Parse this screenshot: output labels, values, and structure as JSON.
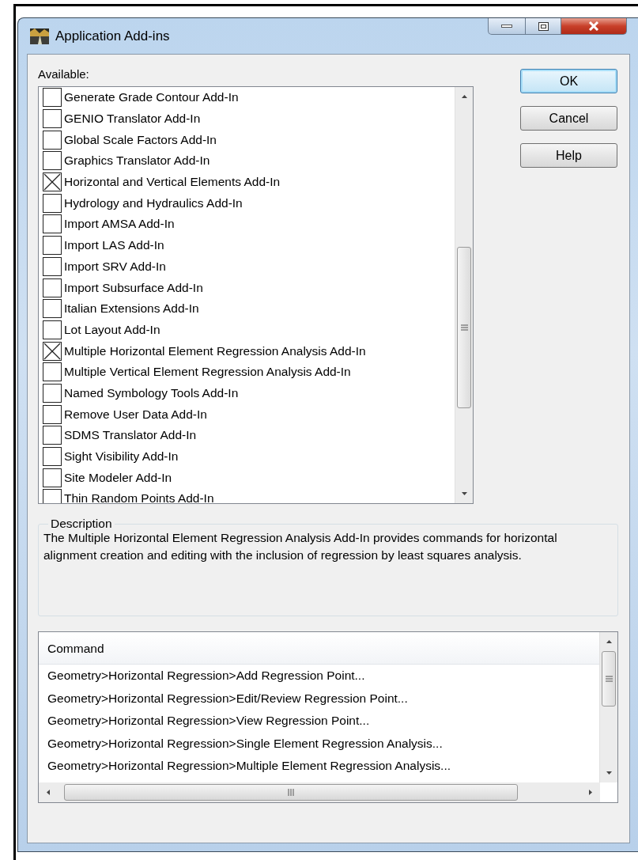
{
  "window": {
    "title": "Application Add-ins"
  },
  "available": {
    "label": "Available:",
    "items": [
      {
        "label": "Generate Grade Contour Add-In",
        "checked": false
      },
      {
        "label": "GENIO Translator Add-In",
        "checked": false
      },
      {
        "label": "Global Scale Factors Add-In",
        "checked": false
      },
      {
        "label": "Graphics Translator Add-In",
        "checked": false
      },
      {
        "label": "Horizontal and Vertical Elements Add-In",
        "checked": true
      },
      {
        "label": "Hydrology and Hydraulics Add-In",
        "checked": false
      },
      {
        "label": "Import AMSA Add-In",
        "checked": false
      },
      {
        "label": "Import LAS Add-In",
        "checked": false
      },
      {
        "label": "Import SRV Add-In",
        "checked": false
      },
      {
        "label": "Import Subsurface Add-In",
        "checked": false
      },
      {
        "label": "Italian Extensions Add-In",
        "checked": false
      },
      {
        "label": "Lot Layout Add-In",
        "checked": false
      },
      {
        "label": "Multiple Horizontal Element Regression Analysis Add-In",
        "checked": true
      },
      {
        "label": "Multiple Vertical Element Regression Analysis Add-In",
        "checked": false
      },
      {
        "label": "Named Symbology Tools Add-In",
        "checked": false
      },
      {
        "label": "Remove User Data Add-In",
        "checked": false
      },
      {
        "label": "SDMS Translator Add-In",
        "checked": false
      },
      {
        "label": "Sight Visibility Add-In",
        "checked": false
      },
      {
        "label": "Site Modeler Add-In",
        "checked": false
      },
      {
        "label": "Thin Random Points Add-In",
        "checked": false
      }
    ]
  },
  "buttons": [
    {
      "label": "OK",
      "default": true
    },
    {
      "label": "Cancel",
      "default": false
    },
    {
      "label": "Help",
      "default": false
    }
  ],
  "description": {
    "legend": "Description",
    "text": "The Multiple Horizontal Element Regression Analysis Add-In provides commands for horizontal alignment creation and editing with the inclusion of regression by least squares analysis."
  },
  "commands": {
    "column": "Command",
    "rows": [
      "Geometry>Horizontal Regression>Add Regression Point...",
      "Geometry>Horizontal Regression>Edit/Review Regression Point...",
      "Geometry>Horizontal Regression>View Regression Point...",
      "Geometry>Horizontal Regression>Single Element Regression Analysis...",
      "Geometry>Horizontal Regression>Multiple Element Regression Analysis..."
    ]
  }
}
